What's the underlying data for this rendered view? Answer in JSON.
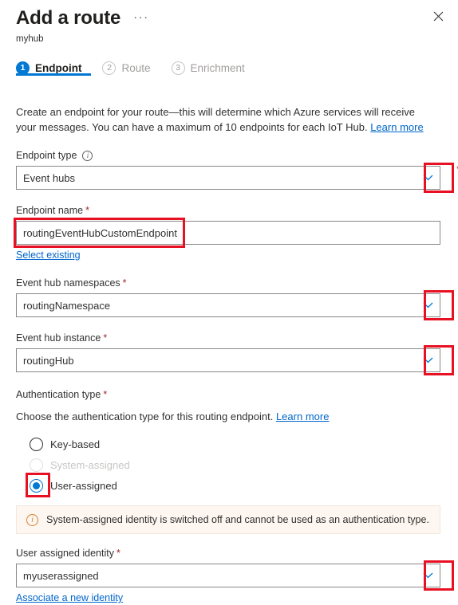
{
  "header": {
    "title": "Add a route",
    "subtitle": "myhub",
    "more_label": "···",
    "close_label": "Close"
  },
  "tabs": [
    {
      "number": "1",
      "label": "Endpoint",
      "state": "active"
    },
    {
      "number": "2",
      "label": "Route",
      "state": "inactive"
    },
    {
      "number": "3",
      "label": "Enrichment",
      "state": "inactive"
    }
  ],
  "intro": {
    "text": "Create an endpoint for your route—this will determine which Azure services will receive your messages. You can have a maximum of 10 endpoints for each IoT Hub.",
    "link": "Learn more"
  },
  "fields": {
    "endpoint_type": {
      "label": "Endpoint type",
      "value": "Event hubs",
      "required_marker": "*",
      "info_glyph": "i"
    },
    "endpoint_name": {
      "label": "Endpoint name",
      "required_marker": "*",
      "value": "routingEventHubCustomEndpoint",
      "placeholder": "",
      "sublink": "Select existing"
    },
    "namespaces": {
      "label": "Event hub namespaces",
      "required_marker": "*",
      "value": "routingNamespace"
    },
    "instance": {
      "label": "Event hub instance",
      "required_marker": "*",
      "value": "routingHub"
    },
    "auth_type": {
      "label": "Authentication type",
      "required_marker": "*",
      "description": "Choose the authentication type for this routing endpoint.",
      "link": "Learn more",
      "options": [
        {
          "label": "Key-based",
          "state": "unchecked"
        },
        {
          "label": "System-assigned",
          "state": "disabled"
        },
        {
          "label": "User-assigned",
          "state": "checked"
        }
      ]
    },
    "banner": {
      "icon": "info-icon",
      "text": "System-assigned identity is switched off and cannot be used as an authentication type."
    },
    "user_identity": {
      "label": "User assigned identity",
      "required_marker": "*",
      "value": "myuserassigned",
      "sublink": "Associate a new identity"
    }
  },
  "colors": {
    "accent": "#0078d4",
    "annotation": "#e81123",
    "required": "#a4262c",
    "link": "#0066cc",
    "banner_bg": "#fdf6f1",
    "banner_icon": "#d9822b"
  }
}
